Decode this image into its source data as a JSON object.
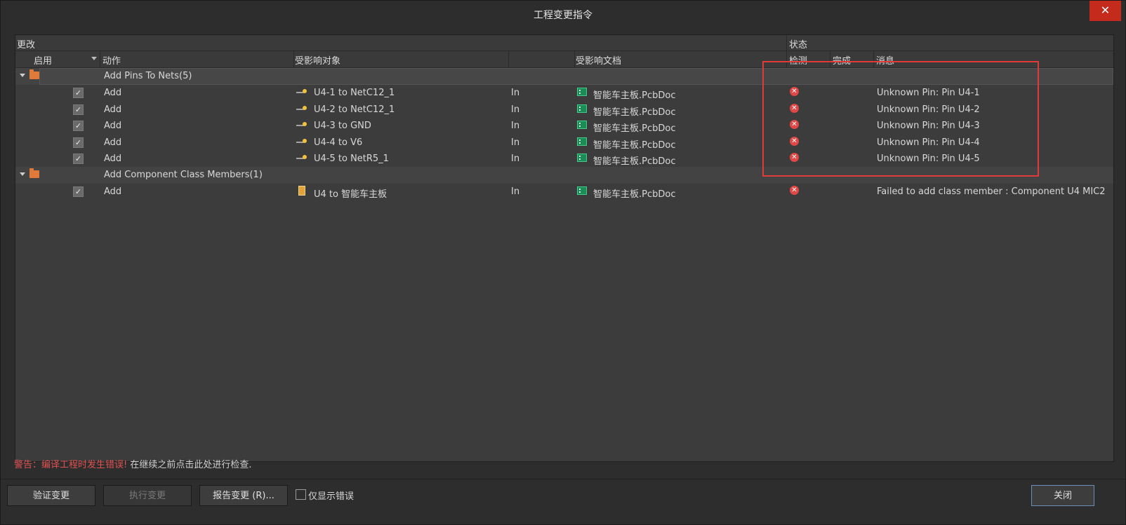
{
  "window": {
    "title": "工程变更指令",
    "close_glyph": "✕"
  },
  "header": {
    "group_changes": "更改",
    "group_status": "状态",
    "col_enable": "启用",
    "col_action": "动作",
    "col_affected_object": "受影响对象",
    "col_affected_document": "受影响文档",
    "col_check": "检测",
    "col_done": "完成",
    "col_message": "消息"
  },
  "groups": [
    {
      "label": "Add Pins To Nets(5)",
      "rows": [
        {
          "enabled": "✓",
          "action": "Add",
          "object": "U4-1 to NetC12_1",
          "direction": "In",
          "document": "智能车主板.PcbDoc",
          "check": "error",
          "message": "Unknown Pin: Pin U4-1"
        },
        {
          "enabled": "✓",
          "action": "Add",
          "object": "U4-2 to NetC12_1",
          "direction": "In",
          "document": "智能车主板.PcbDoc",
          "check": "error",
          "message": "Unknown Pin: Pin U4-2"
        },
        {
          "enabled": "✓",
          "action": "Add",
          "object": "U4-3 to GND",
          "direction": "In",
          "document": "智能车主板.PcbDoc",
          "check": "error",
          "message": "Unknown Pin: Pin U4-3"
        },
        {
          "enabled": "✓",
          "action": "Add",
          "object": "U4-4 to V6",
          "direction": "In",
          "document": "智能车主板.PcbDoc",
          "check": "error",
          "message": "Unknown Pin: Pin U4-4"
        },
        {
          "enabled": "✓",
          "action": "Add",
          "object": "U4-5 to NetR5_1",
          "direction": "In",
          "document": "智能车主板.PcbDoc",
          "check": "error",
          "message": "Unknown Pin: Pin U4-5"
        }
      ]
    },
    {
      "label": "Add Component Class Members(1)",
      "rows": [
        {
          "enabled": "✓",
          "action": "Add",
          "object": "U4 to 智能车主板",
          "direction": "In",
          "document": "智能车主板.PcbDoc",
          "check": "error",
          "message": "Failed to add class member : Component U4 MIC2"
        }
      ]
    }
  ],
  "status_glyph": "✕",
  "warning": {
    "prefix": "警告：编译工程时发生错误!",
    "link": "在继续之前点击此处进行检查."
  },
  "buttons": {
    "validate": "验证变更",
    "execute": "执行变更",
    "report": "报告变更 (R)...",
    "only_errors": "仅显示错误",
    "close": "关闭"
  },
  "colors": {
    "error": "#e04848",
    "highlight": "#e03b3b",
    "warning": "#e05252"
  }
}
